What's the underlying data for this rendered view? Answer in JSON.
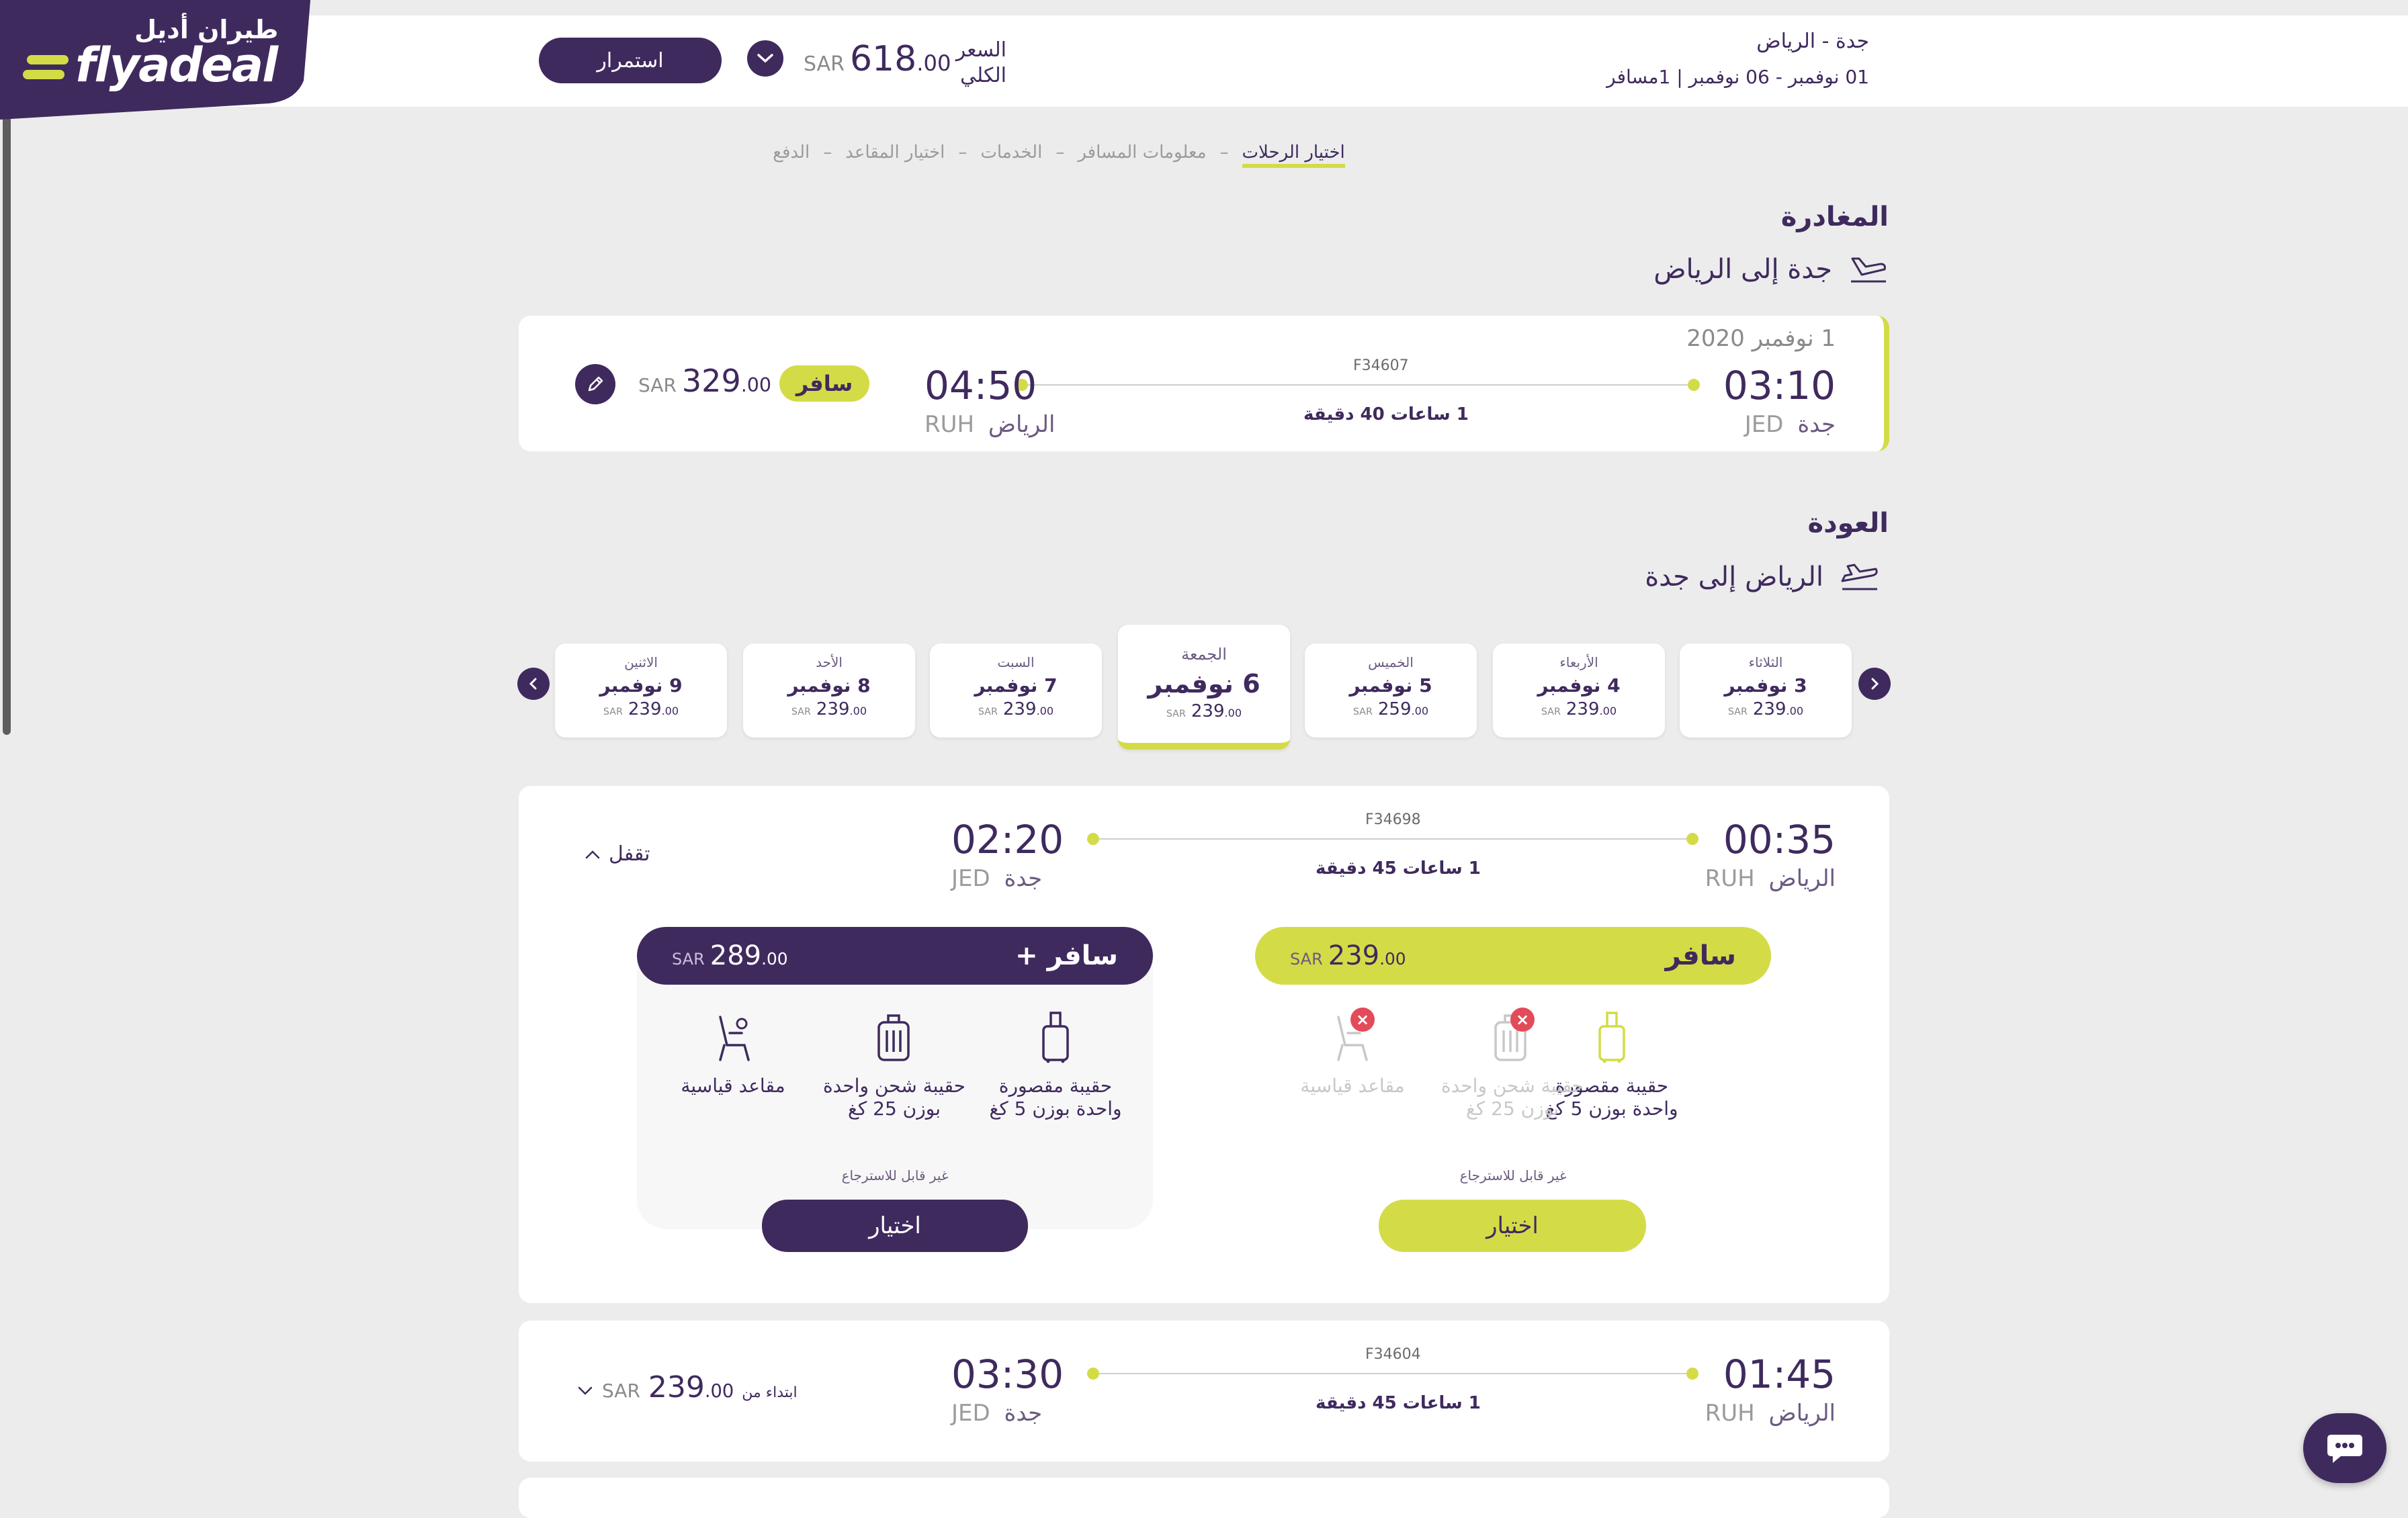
{
  "header": {
    "route": "جدة - الرياض",
    "dates": "01 نوفمبر - 06 نوفمبر | 1مسافر",
    "total_label_line1": "السعر",
    "total_label_line2": "الكلي",
    "total_price_int": "618",
    "total_price_dec": ".00",
    "currency": "SAR",
    "continue_label": "استمرار",
    "logo_arabic": "طيران أديل",
    "logo_latin": "flyadeal"
  },
  "steps": [
    "اختيار الرحلات",
    "معلومات المسافر",
    "الخدمات",
    "اختيار المقاعد",
    "الدفع"
  ],
  "departure": {
    "section_title": "المغادرة",
    "route_title": "جدة إلى الرياض",
    "date": "1 نوفمبر 2020",
    "dep_time": "03:10",
    "dep_city": "جدة",
    "dep_code": "JED",
    "arr_time": "04:50",
    "arr_city": "الرياض",
    "arr_code": "RUH",
    "flight_no": "F34607",
    "duration": "1 ساعات 40 دقيقة",
    "fare_badge": "سافر",
    "price_int": "329",
    "price_dec": ".00",
    "currency": "SAR"
  },
  "return": {
    "section_title": "العودة",
    "route_title": "الرياض إلى جدة",
    "dates": [
      {
        "day": "الثلاثاء",
        "date": "3 نوفمبر",
        "price": "239",
        "dec": ".00"
      },
      {
        "day": "الأربعاء",
        "date": "4 نوفمبر",
        "price": "239",
        "dec": ".00"
      },
      {
        "day": "الخميس",
        "date": "5 نوفمبر",
        "price": "259",
        "dec": ".00"
      },
      {
        "day": "الجمعة",
        "date": "6 نوفمبر",
        "price": "239",
        "dec": ".00"
      },
      {
        "day": "السبت",
        "date": "7 نوفمبر",
        "price": "239",
        "dec": ".00"
      },
      {
        "day": "الأحد",
        "date": "8 نوفمبر",
        "price": "239",
        "dec": ".00"
      },
      {
        "day": "الاثنين",
        "date": "9 نوفمبر",
        "price": "239",
        "dec": ".00"
      }
    ],
    "currency": "SAR",
    "selected_index": 3
  },
  "flight1": {
    "dep_time": "00:35",
    "dep_city": "الرياض",
    "dep_code": "RUH",
    "arr_time": "02:20",
    "arr_city": "جدة",
    "arr_code": "JED",
    "flight_no": "F34698",
    "duration": "1 ساعات 45 دقيقة",
    "collapse_label": "تقفل",
    "fare_basic": {
      "name": "سافر",
      "price_int": "239",
      "price_dec": ".00",
      "features": [
        "حقيبة مقصورة واحدة بوزن 5 كغ",
        "حقيبة شحن واحدة بوزن 25 كغ",
        "مقاعد قياسية"
      ],
      "non_refundable": "غير قابل للاسترجاع",
      "select_label": "اختيار"
    },
    "fare_plus": {
      "name": "سافر +",
      "price_int": "289",
      "price_dec": ".00",
      "features": [
        "حقيبة مقصورة واحدة بوزن 5 كغ",
        "حقيبة شحن واحدة بوزن 25 كغ",
        "مقاعد قياسية"
      ],
      "non_refundable": "غير قابل للاسترجاع",
      "select_label": "اختيار"
    },
    "currency": "SAR"
  },
  "flight2": {
    "dep_time": "01:45",
    "dep_city": "الرياض",
    "dep_code": "RUH",
    "arr_time": "03:30",
    "arr_city": "جدة",
    "arr_code": "JED",
    "flight_no": "F34604",
    "duration": "1 ساعات 45 دقيقة",
    "from_label": "ابتداء من",
    "price_int": "239",
    "price_dec": ".00",
    "currency": "SAR"
  },
  "colors": {
    "brand_purple": "#3f2a5e",
    "brand_lime": "#d3dc47",
    "error_red": "#e34b5a"
  }
}
